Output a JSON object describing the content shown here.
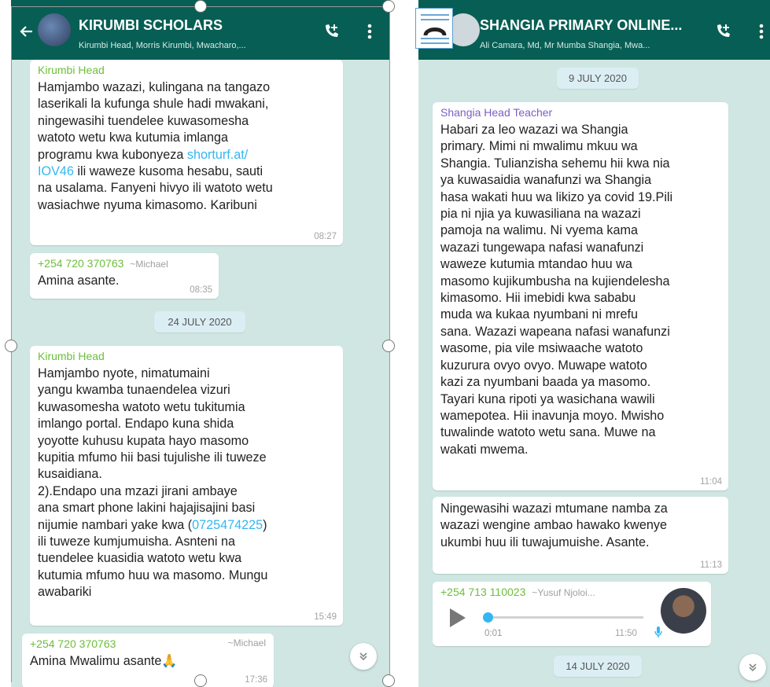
{
  "left": {
    "header": {
      "title": "KIRUMBI SCHOLARS",
      "subtitle": "Kirumbi Head, Morris Kirumbi, Mwacharo,..."
    },
    "messages": [
      {
        "sender": "Kirumbi Head",
        "text_a": "Hamjambo wazazi, kulingana na tangazo\nlaserikali la kufunga shule hadi mwakani,\nningewasihi tuendelee kuwasomesha\nwatoto wetu kwa kutumia imlanga\nprogramu kwa kubonyeza ",
        "link": "shorturf.at/\nIOV46",
        "text_b": " ili waweze kusoma hesabu, sauti\nna usalama. Fanyeni hivyo ili watoto wetu\nwasiachwe nyuma kimasomo. Karibuni",
        "time": "08:27"
      },
      {
        "sender": "+254 720 370763",
        "sender_name": "~Michael",
        "text": "Amina asante.",
        "time": "08:35"
      },
      {
        "sender": "Kirumbi Head",
        "text_a": "Hamjambo nyote, nimatumaini\nyangu kwamba tunaendelea vizuri\nkuwasomesha watoto wetu tukitumia\nimlango portal. Endapo kuna shida\nyoyotte kuhusu kupata hayo masomo\nkupitia mfumo hii basi tujulishe ili tuweze\nkusaidiana.\n2).Endapo una mzazi jirani ambaye\nana smart phone lakini hajajisajini basi\nnijumie nambari yake kwa (",
        "link": "0725474225",
        "text_b": ")\nili tuweze kumjumuisha. Asnteni na\ntuendelee kuasidia watoto wetu kwa\nkutumia mfumo huu wa masomo. Mungu\nawabariki",
        "time": "15:49"
      },
      {
        "sender": "+254 720 370763",
        "sender_name": "~Michael",
        "text": "Amina Mwalimu asante🙏",
        "time": "17:36"
      }
    ],
    "date_pill": "24 JULY 2020"
  },
  "right": {
    "header": {
      "title": "SHANGIA PRIMARY ONLINE...",
      "subtitle": "Ali Camara, Md, Mr Mumba Shangia, Mwa..."
    },
    "date_pill_top": "9 JULY 2020",
    "messages": [
      {
        "sender": "Shangia Head Teacher",
        "text": "Habari za leo wazazi wa Shangia\nprimary. Mimi ni mwalimu mkuu wa\nShangia. Tulianzisha sehemu hii kwa nia\nya kuwasaidia wanafunzi wa Shangia\nhasa wakati huu wa likizo ya covid 19.Pili\npia ni njia ya kuwasiliana na wazazi\npamoja na walimu. Ni vyema kama\nwazazi tungewapa nafasi wanafunzi\nwaweze kutumia mtandao huu wa\nmasomo kujikumbusha na kujiendelesha\nkimasomo. Hii imebidi kwa sababu\nmuda wa kukaa nyumbani ni mrefu\nsana. Wazazi wapeana nafasi wanafunzi\nwasome, pia vile msiwaache watoto\nkuzurura ovyo ovyo. Muwape watoto\nkazi za nyumbani baada ya masomo.\nTayari kuna ripoti ya wasichana wawili\nwamepotea. Hii inavunja moyo. Mwisho\ntuwalinde watoto wetu sana. Muwe na\nwakati mwema.",
        "time": "11:04"
      },
      {
        "text": "Ningewasihi wazazi mtumane namba za\nwazazi wengine ambao hawako kwenye\nukumbi huu ili tuwajumuishe. Asante.",
        "time": "11:13"
      }
    ],
    "audio": {
      "sender": "+254 713 110023",
      "sender_name": "~Yusuf Njoloi...",
      "duration": "0:01",
      "time": "11:50",
      "progress": 0.0
    },
    "date_pill_bottom": "14 JULY 2020"
  },
  "colors": {
    "header": "#075e54",
    "chat_bg": "#cfe6e2",
    "sender_green": "#6cbf3a",
    "sender_purple": "#7b5fc7",
    "link": "#34b7f1"
  },
  "icons": [
    "back-arrow-icon",
    "group-avatar-icon",
    "add-call-icon",
    "more-vert-icon",
    "scroll-down-icon",
    "play-icon",
    "mic-icon",
    "image-edit-icon"
  ]
}
